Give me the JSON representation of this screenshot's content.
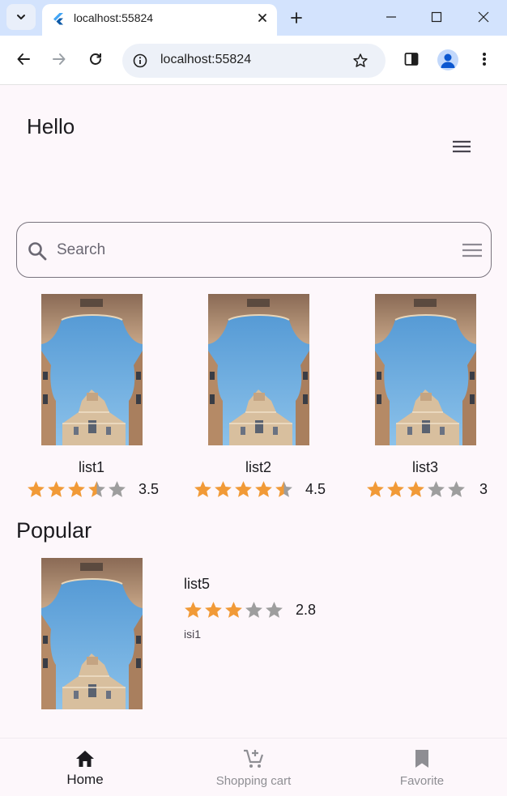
{
  "browser": {
    "tab_title": "localhost:55824",
    "url": "localhost:55824"
  },
  "app": {
    "greeting": "Hello",
    "search": {
      "placeholder": "Search",
      "value": ""
    },
    "cards": [
      {
        "title": "list1",
        "rating": 3.5,
        "rating_text": "3.5"
      },
      {
        "title": "list2",
        "rating": 4.5,
        "rating_text": "4.5"
      },
      {
        "title": "list3",
        "rating": 3,
        "rating_text": "3"
      }
    ],
    "popular": {
      "heading": "Popular",
      "item": {
        "title": "list5",
        "rating": 2.8,
        "rating_text": "2.8",
        "description": "isi1"
      }
    },
    "bottom_nav": [
      {
        "label": "Home",
        "icon": "home-icon",
        "active": true
      },
      {
        "label": "Shopping cart",
        "icon": "add-shopping-cart-icon",
        "active": false
      },
      {
        "label": "Favorite",
        "icon": "bookmark-icon",
        "active": false
      }
    ]
  },
  "colors": {
    "star_filled": "#f19a37",
    "star_empty": "#9e9e9e",
    "nav_active": "#1c1b1f",
    "nav_inactive": "#8e8e93",
    "app_background": "#fdf7fb"
  }
}
